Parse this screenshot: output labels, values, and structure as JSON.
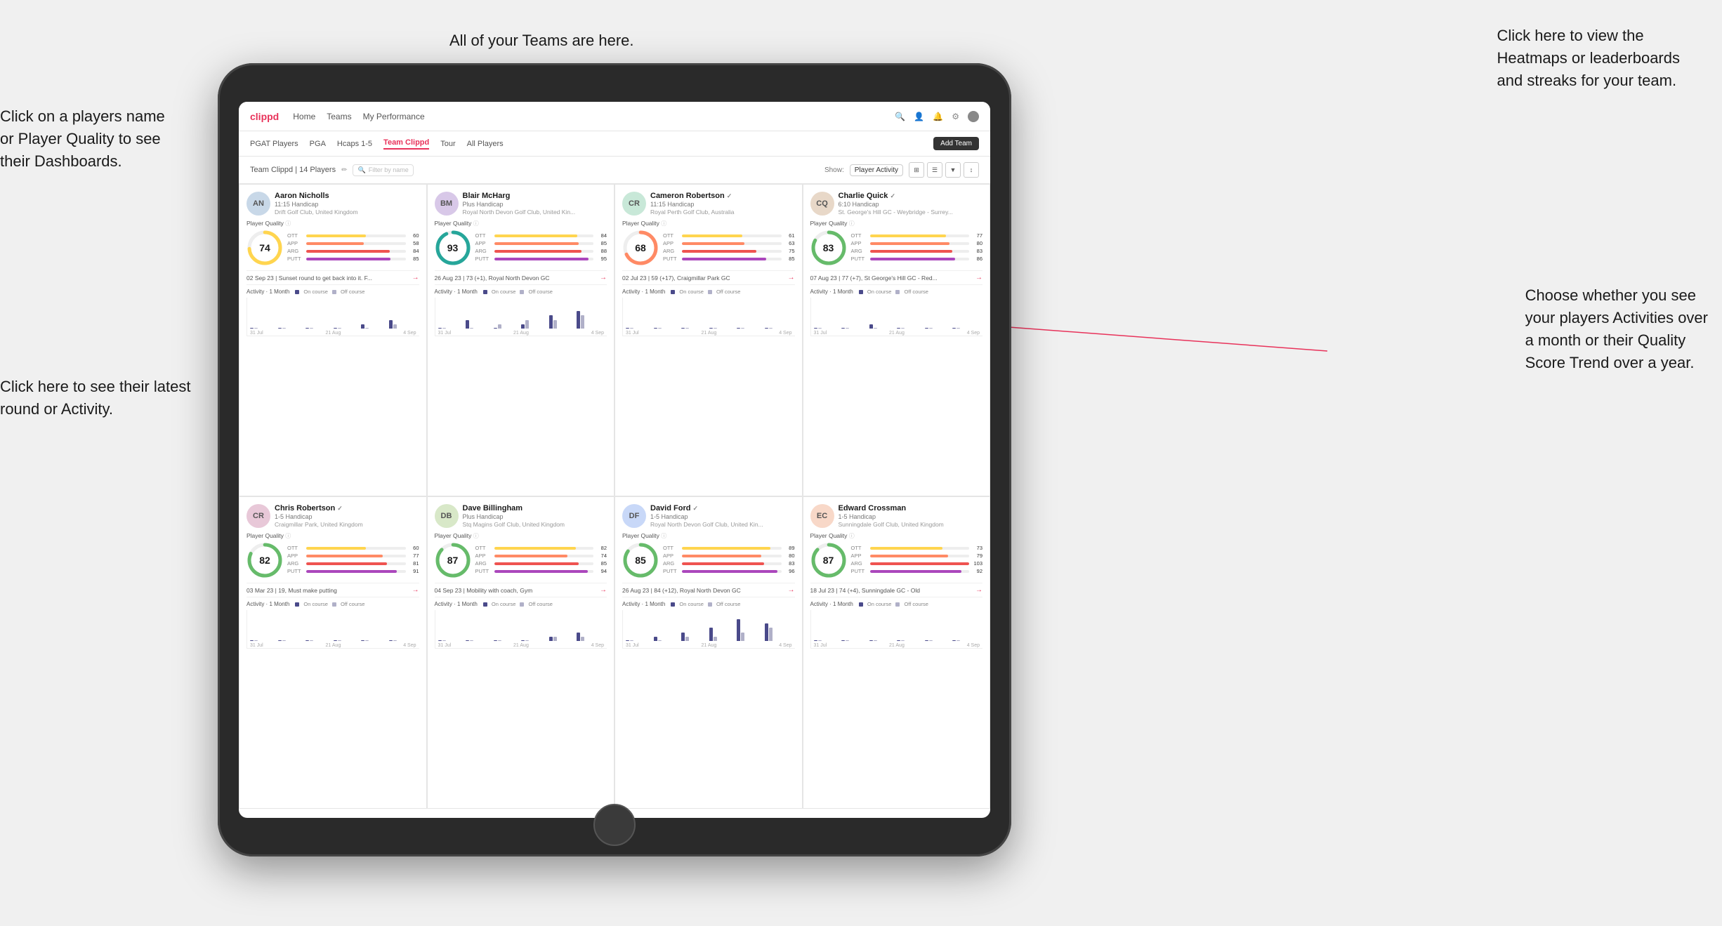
{
  "annotations": {
    "teams_tooltip": "All of your Teams are here.",
    "heatmaps_tooltip": "Click here to view the\nHeatmaps or leaderboards\nand streaks for your team.",
    "player_name_tooltip": "Click on a players name\nor Player Quality to see\ntheir Dashboards.",
    "round_tooltip": "Click here to see their latest\nround or Activity.",
    "activities_tooltip": "Choose whether you see\nyour players Activities over\na month or their Quality\nScore Trend over a year."
  },
  "nav": {
    "logo": "clippd",
    "links": [
      "Home",
      "Teams",
      "My Performance"
    ],
    "add_team": "Add Team"
  },
  "sub_tabs": {
    "tabs": [
      "PGAT Players",
      "PGA",
      "Hcaps 1-5",
      "Team Clippd",
      "Tour",
      "All Players"
    ]
  },
  "team_header": {
    "name": "Team Clippd | 14 Players",
    "filter_placeholder": "Filter by name",
    "show_label": "Show:",
    "show_options": [
      "Player Activity"
    ],
    "selected_option": "Player Activity"
  },
  "players": [
    {
      "id": "aaron-nicholls",
      "name": "Aaron Nicholls",
      "handicap": "11:15 Handicap",
      "club": "Drift Golf Club, United Kingdom",
      "quality": 74,
      "quality_color": "#4fc3f7",
      "verified": false,
      "stats": {
        "OTT": {
          "value": 60,
          "color": "#ffd54f"
        },
        "APP": {
          "value": 58,
          "color": "#ff8a65"
        },
        "ARG": {
          "value": 84,
          "color": "#ef5350"
        },
        "PUTT": {
          "value": 85,
          "color": "#ab47bc"
        }
      },
      "recent_round": "02 Sep 23 | Sunset round to get back into it. F...",
      "chart_bars": [
        {
          "on": 0,
          "off": 0
        },
        {
          "on": 0,
          "off": 0
        },
        {
          "on": 0,
          "off": 0
        },
        {
          "on": 0,
          "off": 0
        },
        {
          "on": 1,
          "off": 0
        },
        {
          "on": 2,
          "off": 1
        }
      ],
      "chart_dates": [
        "31 Jul",
        "21 Aug",
        "4 Sep"
      ]
    },
    {
      "id": "blair-mcharg",
      "name": "Blair McHarg",
      "handicap": "Plus Handicap",
      "club": "Royal North Devon Golf Club, United Kin...",
      "quality": 93,
      "quality_color": "#26a69a",
      "verified": false,
      "stats": {
        "OTT": {
          "value": 84,
          "color": "#ffd54f"
        },
        "APP": {
          "value": 85,
          "color": "#ff8a65"
        },
        "ARG": {
          "value": 88,
          "color": "#ef5350"
        },
        "PUTT": {
          "value": 95,
          "color": "#ab47bc"
        }
      },
      "recent_round": "26 Aug 23 | 73 (+1), Royal North Devon GC",
      "chart_bars": [
        {
          "on": 0,
          "off": 0
        },
        {
          "on": 2,
          "off": 0
        },
        {
          "on": 0,
          "off": 1
        },
        {
          "on": 1,
          "off": 2
        },
        {
          "on": 3,
          "off": 2
        },
        {
          "on": 4,
          "off": 3
        }
      ],
      "chart_dates": [
        "31 Jul",
        "21 Aug",
        "4 Sep"
      ]
    },
    {
      "id": "cameron-robertson",
      "name": "Cameron Robertson",
      "handicap": "11:15 Handicap",
      "club": "Royal Perth Golf Club, Australia",
      "quality": 68,
      "quality_color": "#ffb300",
      "verified": true,
      "stats": {
        "OTT": {
          "value": 61,
          "color": "#ffd54f"
        },
        "APP": {
          "value": 63,
          "color": "#ff8a65"
        },
        "ARG": {
          "value": 75,
          "color": "#ef5350"
        },
        "PUTT": {
          "value": 85,
          "color": "#ab47bc"
        }
      },
      "recent_round": "02 Jul 23 | 59 (+17), Craigmillar Park GC",
      "chart_bars": [
        {
          "on": 0,
          "off": 0
        },
        {
          "on": 0,
          "off": 0
        },
        {
          "on": 0,
          "off": 0
        },
        {
          "on": 0,
          "off": 0
        },
        {
          "on": 0,
          "off": 0
        },
        {
          "on": 0,
          "off": 0
        }
      ],
      "chart_dates": [
        "31 Jul",
        "21 Aug",
        "4 Sep"
      ]
    },
    {
      "id": "charlie-quick",
      "name": "Charlie Quick",
      "handicap": "6:10 Handicap",
      "club": "St. George's Hill GC - Weybridge - Surrey...",
      "quality": 83,
      "quality_color": "#66bb6a",
      "verified": true,
      "stats": {
        "OTT": {
          "value": 77,
          "color": "#ffd54f"
        },
        "APP": {
          "value": 80,
          "color": "#ff8a65"
        },
        "ARG": {
          "value": 83,
          "color": "#ef5350"
        },
        "PUTT": {
          "value": 86,
          "color": "#ab47bc"
        }
      },
      "recent_round": "07 Aug 23 | 77 (+7), St George's Hill GC - Red...",
      "chart_bars": [
        {
          "on": 0,
          "off": 0
        },
        {
          "on": 0,
          "off": 0
        },
        {
          "on": 1,
          "off": 0
        },
        {
          "on": 0,
          "off": 0
        },
        {
          "on": 0,
          "off": 0
        },
        {
          "on": 0,
          "off": 0
        }
      ],
      "chart_dates": [
        "31 Jul",
        "21 Aug",
        "4 Sep"
      ]
    },
    {
      "id": "chris-robertson",
      "name": "Chris Robertson",
      "handicap": "1-5 Handicap",
      "club": "Craigmillar Park, United Kingdom",
      "quality": 82,
      "quality_color": "#66bb6a",
      "verified": true,
      "stats": {
        "OTT": {
          "value": 60,
          "color": "#ffd54f"
        },
        "APP": {
          "value": 77,
          "color": "#ff8a65"
        },
        "ARG": {
          "value": 81,
          "color": "#ef5350"
        },
        "PUTT": {
          "value": 91,
          "color": "#ab47bc"
        }
      },
      "recent_round": "03 Mar 23 | 19, Must make putting",
      "chart_bars": [
        {
          "on": 0,
          "off": 0
        },
        {
          "on": 0,
          "off": 0
        },
        {
          "on": 0,
          "off": 0
        },
        {
          "on": 0,
          "off": 0
        },
        {
          "on": 0,
          "off": 0
        },
        {
          "on": 0,
          "off": 0
        }
      ],
      "chart_dates": [
        "31 Jul",
        "21 Aug",
        "4 Sep"
      ]
    },
    {
      "id": "dave-billingham",
      "name": "Dave Billingham",
      "handicap": "Plus Handicap",
      "club": "Stq Magins Golf Club, United Kingdom",
      "quality": 87,
      "quality_color": "#26a69a",
      "verified": false,
      "stats": {
        "OTT": {
          "value": 82,
          "color": "#ffd54f"
        },
        "APP": {
          "value": 74,
          "color": "#ff8a65"
        },
        "ARG": {
          "value": 85,
          "color": "#ef5350"
        },
        "PUTT": {
          "value": 94,
          "color": "#ab47bc"
        }
      },
      "recent_round": "04 Sep 23 | Mobility with coach, Gym",
      "chart_bars": [
        {
          "on": 0,
          "off": 0
        },
        {
          "on": 0,
          "off": 0
        },
        {
          "on": 0,
          "off": 0
        },
        {
          "on": 0,
          "off": 0
        },
        {
          "on": 1,
          "off": 1
        },
        {
          "on": 2,
          "off": 1
        }
      ],
      "chart_dates": [
        "31 Jul",
        "21 Aug",
        "4 Sep"
      ]
    },
    {
      "id": "david-ford",
      "name": "David Ford",
      "handicap": "1-5 Handicap",
      "club": "Royal North Devon Golf Club, United Kin...",
      "quality": 85,
      "quality_color": "#66bb6a",
      "verified": true,
      "stats": {
        "OTT": {
          "value": 89,
          "color": "#ffd54f"
        },
        "APP": {
          "value": 80,
          "color": "#ff8a65"
        },
        "ARG": {
          "value": 83,
          "color": "#ef5350"
        },
        "PUTT": {
          "value": 96,
          "color": "#ab47bc"
        }
      },
      "recent_round": "26 Aug 23 | 84 (+12), Royal North Devon GC",
      "chart_bars": [
        {
          "on": 0,
          "off": 0
        },
        {
          "on": 1,
          "off": 0
        },
        {
          "on": 2,
          "off": 1
        },
        {
          "on": 3,
          "off": 1
        },
        {
          "on": 5,
          "off": 2
        },
        {
          "on": 4,
          "off": 3
        }
      ],
      "chart_dates": [
        "31 Jul",
        "21 Aug",
        "4 Sep"
      ]
    },
    {
      "id": "edward-crossman",
      "name": "Edward Crossman",
      "handicap": "1-5 Handicap",
      "club": "Sunningdale Golf Club, United Kingdom",
      "quality": 87,
      "quality_color": "#26a69a",
      "verified": false,
      "stats": {
        "OTT": {
          "value": 73,
          "color": "#ffd54f"
        },
        "APP": {
          "value": 79,
          "color": "#ff8a65"
        },
        "ARG": {
          "value": 103,
          "color": "#ef5350"
        },
        "PUTT": {
          "value": 92,
          "color": "#ab47bc"
        }
      },
      "recent_round": "18 Jul 23 | 74 (+4), Sunningdale GC - Old",
      "chart_bars": [
        {
          "on": 0,
          "off": 0
        },
        {
          "on": 0,
          "off": 0
        },
        {
          "on": 0,
          "off": 0
        },
        {
          "on": 0,
          "off": 0
        },
        {
          "on": 0,
          "off": 0
        },
        {
          "on": 0,
          "off": 0
        }
      ],
      "chart_dates": [
        "31 Jul",
        "21 Aug",
        "4 Sep"
      ]
    }
  ],
  "activity_labels": {
    "title": "Activity · 1 Month",
    "on_course": "On course",
    "off_course": "Off course"
  },
  "colors": {
    "brand": "#e8325a",
    "on_course": "#4a4a8a",
    "off_course": "#b0b0c8",
    "nav_bg": "#ffffff",
    "card_border": "#e5e5e5"
  }
}
